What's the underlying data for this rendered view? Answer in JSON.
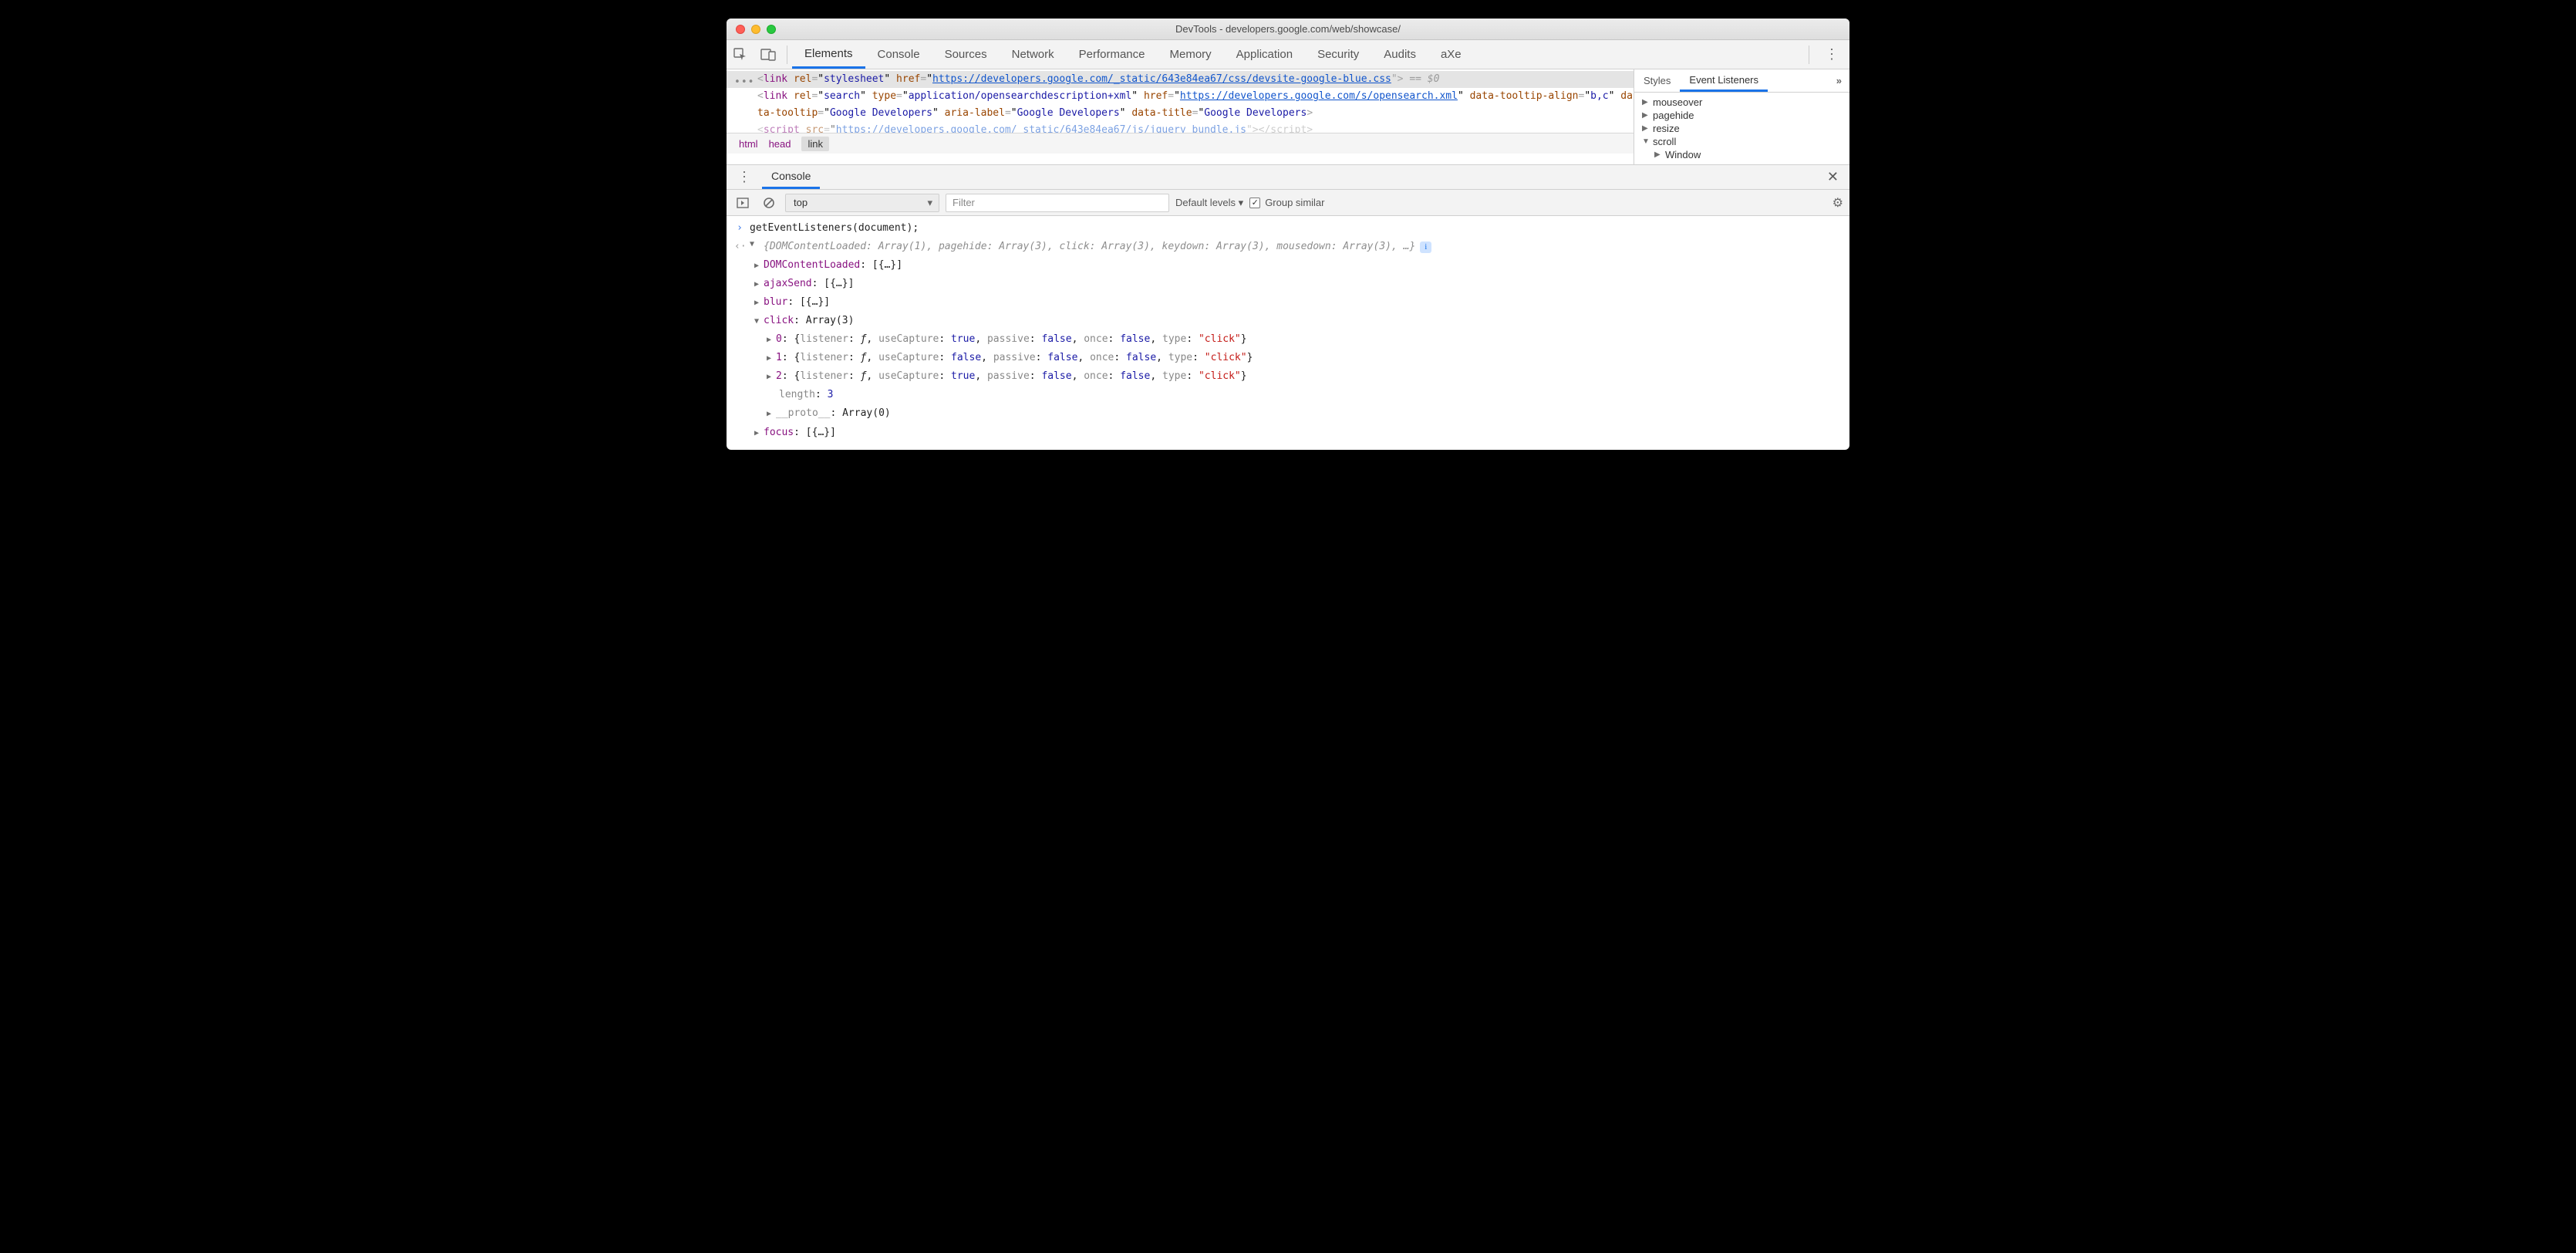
{
  "titlebar": {
    "title": "DevTools - developers.google.com/web/showcase/"
  },
  "tabs": {
    "items": [
      "Elements",
      "Console",
      "Sources",
      "Network",
      "Performance",
      "Memory",
      "Application",
      "Security",
      "Audits",
      "aXe"
    ],
    "active": 0
  },
  "dom": {
    "line1": {
      "open": "<link ",
      "rel_attr": "rel",
      "rel_val": "stylesheet",
      "href_attr": "href",
      "url": "https://developers.google.com/_static/643e84ea67/css/devsite-google-blue.css",
      "close": "\">",
      "eq0": " == $0"
    },
    "line2": {
      "open": "<link ",
      "rel_attr": "rel",
      "rel_val": "search",
      "type_attr": "type",
      "type_val": "application/opensearchdescription+xml",
      "href_attr": "href",
      "url": "https://developers.google.com/s/opensearch.xml",
      "dta_attr": "data-tooltip-align",
      "dta_val": "b,c",
      "dt_attr": "data-tooltip",
      "dt_val": "Google Developers",
      "al_attr": "aria-label",
      "al_val": "Google Developers",
      "dtt_attr": "data-title",
      "dtt_val": "Google Developers",
      "close": ">"
    },
    "line3": {
      "open": "<script ",
      "src_attr": "src",
      "url": "https://developers.google.com/_static/643e84ea67/js/jquery_bundle.js",
      "mid": "\"></scrip",
      "end": "t>"
    }
  },
  "crumbs": {
    "a": "html",
    "b": "head",
    "c": "link"
  },
  "side": {
    "tabs": {
      "styles": "Styles",
      "listeners": "Event Listeners",
      "more": "»"
    },
    "events": [
      "mouseover",
      "pagehide",
      "resize",
      "scroll"
    ],
    "scroll_child": "Window"
  },
  "drawer": {
    "tab": "Console"
  },
  "toolbar": {
    "context": "top",
    "filter_placeholder": "Filter",
    "levels": "Default levels ▾",
    "group": "Group similar"
  },
  "console": {
    "input": "getEventListeners(document);",
    "summary": "{DOMContentLoaded: Array(1), pagehide: Array(3), click: Array(3), keydown: Array(3), mousedown: Array(3), …}",
    "p_dom": "DOMContentLoaded",
    "v_dom": "[{…}]",
    "p_ajax": "ajaxSend",
    "v_ajax": "[{…}]",
    "p_blur": "blur",
    "v_blur": "[{…}]",
    "p_click": "click",
    "v_click": "Array(3)",
    "click_items": [
      {
        "idx": "0",
        "useCapture": "true"
      },
      {
        "idx": "1",
        "useCapture": "false"
      },
      {
        "idx": "2",
        "useCapture": "true"
      }
    ],
    "labels": {
      "listener": "listener",
      "f": "ƒ",
      "useCapture": "useCapture",
      "passive": "passive",
      "passive_v": "false",
      "once": "once",
      "once_v": "false",
      "type": "type",
      "type_v": "\"click\""
    },
    "length_k": "length",
    "length_v": "3",
    "proto_k": "__proto__",
    "proto_v": "Array(0)",
    "p_focus": "focus",
    "v_focus": "[{…}]"
  }
}
